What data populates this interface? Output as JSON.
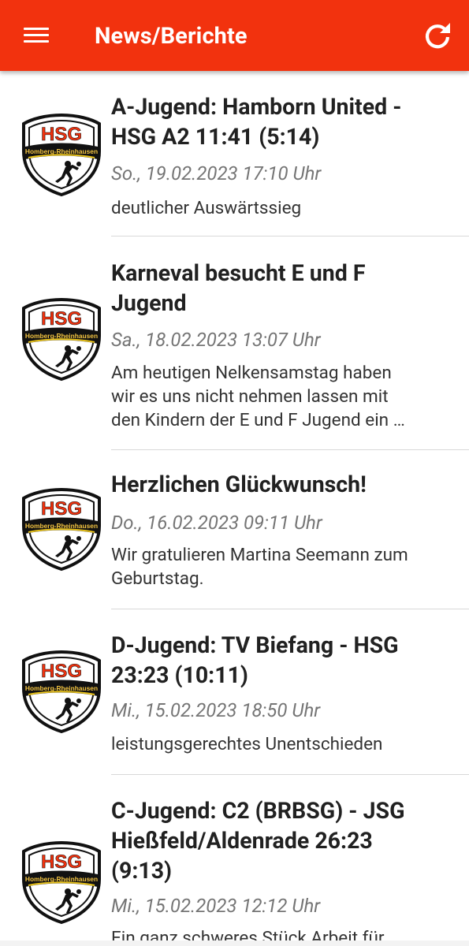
{
  "appbar": {
    "title": "News/Berichte",
    "color": "#f2320e"
  },
  "logo": {
    "brand_text": "HSG",
    "banner_text": "Homberg-Rheinhausen",
    "brand_color": "#f2320e"
  },
  "news": [
    {
      "title_lines": [
        "A-Jugend: Hamborn United -",
        "HSG A2 11:41 (5:14)"
      ],
      "date": "So., 19.02.2023 17:10 Uhr",
      "desc_lines": [
        "deutlicher Auswärtssieg"
      ]
    },
    {
      "title_lines": [
        "Karneval besucht E und F",
        "Jugend"
      ],
      "date": "Sa., 18.02.2023 13:07 Uhr",
      "desc_lines": [
        "Am heutigen Nelkensamstag haben",
        "wir es uns nicht nehmen lassen mit",
        "den Kindern der E und F Jugend ein …"
      ]
    },
    {
      "title_lines": [
        "Herzlichen Glückwunsch!"
      ],
      "date": "Do., 16.02.2023 09:11 Uhr",
      "desc_lines": [
        "Wir gratulieren Martina Seemann zum",
        "Geburtstag."
      ]
    },
    {
      "title_lines": [
        "D-Jugend: TV Biefang - HSG",
        "23:23 (10:11)"
      ],
      "date": "Mi., 15.02.2023 18:50 Uhr",
      "desc_lines": [
        "leistungsgerechtes Unentschieden"
      ]
    },
    {
      "title_lines": [
        "C-Jugend: C2 (BRBSG) - JSG",
        "Hießfeld/Aldenrade 26:23",
        "(9:13)"
      ],
      "date": "Mi., 15.02.2023 12:12 Uhr",
      "desc_lines": [
        "Ein ganz schweres Stück Arbeit für"
      ]
    }
  ]
}
